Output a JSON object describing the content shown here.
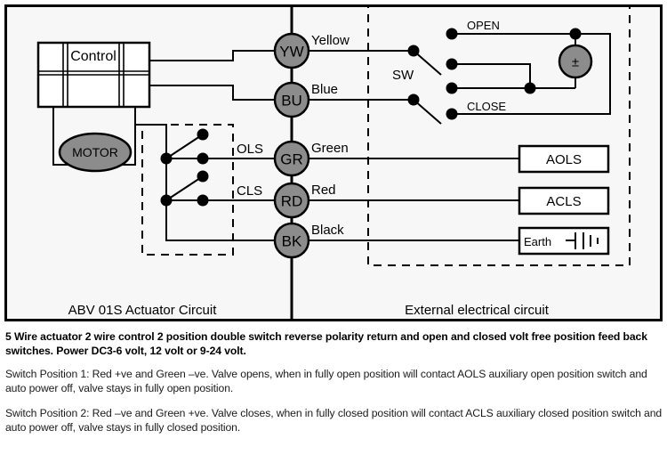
{
  "diagram": {
    "panels": [
      {
        "id": "left",
        "label": "ABV 01S Actuator Circuit"
      },
      {
        "id": "right",
        "label": "External electrical circuit"
      }
    ],
    "control_box": {
      "label": "Control"
    },
    "motor": {
      "label": "MOTOR"
    },
    "limit_switches": [
      {
        "id": "ols",
        "label": "OLS"
      },
      {
        "id": "cls",
        "label": "CLS"
      }
    ],
    "terminals": [
      {
        "code": "YW",
        "wire_color_name": "Yellow"
      },
      {
        "code": "BU",
        "wire_color_name": "Blue"
      },
      {
        "code": "GR",
        "wire_color_name": "Green"
      },
      {
        "code": "RD",
        "wire_color_name": "Red"
      },
      {
        "code": "BK",
        "wire_color_name": "Black"
      }
    ],
    "switch": {
      "label": "SW",
      "positions": [
        "OPEN",
        "CLOSE"
      ]
    },
    "supply": {
      "symbol": "±"
    },
    "external_blocks": [
      {
        "id": "aols",
        "label": "AOLS"
      },
      {
        "id": "acls",
        "label": "ACLS"
      },
      {
        "id": "earth",
        "label": "Earth"
      }
    ],
    "colors": {
      "terminal_fill": "#8c8c8c",
      "motor_fill": "#8c8c8c",
      "line": "#000000",
      "panel_fill": "#f7f7f7"
    }
  },
  "captions": {
    "headline": "5 Wire actuator 2 wire control 2 position double switch reverse polarity return and open and closed volt free position feed back switches. Power DC3-6 volt, 12 volt or 9-24 volt.",
    "position_1": "Switch Position 1: Red +ve and Green –ve. Valve opens, when in fully open position will contact AOLS auxiliary open position switch and auto power off, valve stays in fully open position.",
    "position_2": "Switch Position 2: Red –ve and Green +ve. Valve closes, when in fully closed position will contact ACLS auxiliary closed position switch and auto power off, valve stays in fully closed position."
  }
}
